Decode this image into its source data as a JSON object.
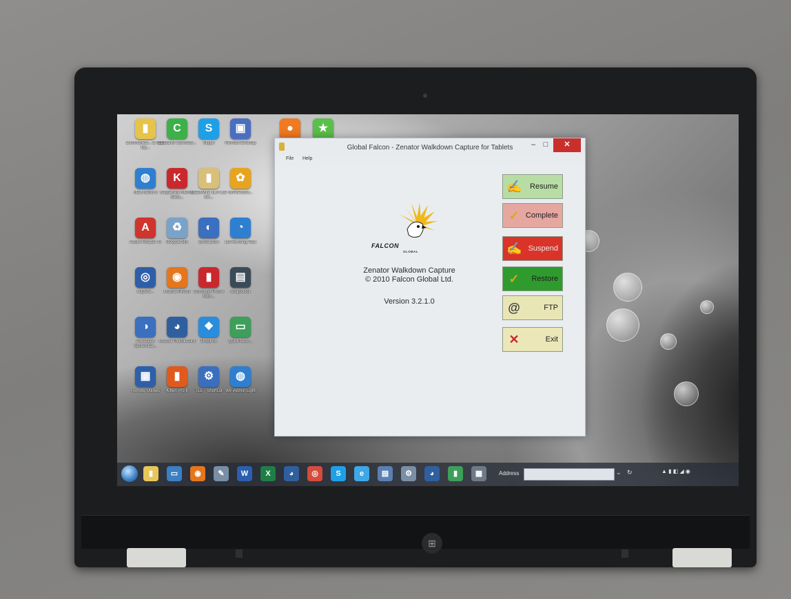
{
  "desktop": {
    "icons": [
      {
        "label": "Communica... & Start Up...",
        "color": "#e6c34a",
        "glyph": "▮"
      },
      {
        "label": "CCleaner Connecti...",
        "color": "#3db04a",
        "glyph": "C"
      },
      {
        "label": "Skype",
        "color": "#1ea0e8",
        "glyph": "S"
      },
      {
        "label": "Remote Desktop",
        "color": "#4a6fbf",
        "glyph": "▣"
      },
      {
        "label": "",
        "color": "#f07a22",
        "glyph": "●"
      },
      {
        "label": "",
        "color": "#5bbf4c",
        "glyph": "★"
      },
      {
        "label": "Start Menu 8",
        "color": "#2f7fd0",
        "glyph": "◍"
      },
      {
        "label": "Kaspersky Internet Secu...",
        "color": "#c9282d",
        "glyph": "K"
      },
      {
        "label": "ReadWrite 11.0 Lite UK...",
        "color": "#d8c07a",
        "glyph": "▮"
      },
      {
        "label": "GoToAssist...",
        "color": "#e8a41e",
        "glyph": "✿"
      },
      {
        "label": "Adobe Reader XI",
        "color": "#d0342c",
        "glyph": "A"
      },
      {
        "label": "Recycle Bin",
        "color": "#7aa3c9",
        "glyph": "♻"
      },
      {
        "label": "28.05.2014",
        "color": "#3b6fbf",
        "glyph": "◐"
      },
      {
        "label": "LG Running Tool",
        "color": "#2f7fd0",
        "glyph": "◔"
      },
      {
        "label": "wap5.5...",
        "color": "#2d5fa8",
        "glyph": "◎"
      },
      {
        "label": "Mozilla Firefox",
        "color": "#e4761d",
        "glyph": "◉"
      },
      {
        "label": "Combofix Phone Infor...",
        "color": "#c9282d",
        "glyph": "▮"
      },
      {
        "label": "wsapiclock",
        "color": "#3b4a57",
        "glyph": "▤"
      },
      {
        "label": "Advanced SystemCa...",
        "color": "#3b6fbf",
        "glyph": "◑"
      },
      {
        "label": "Mozilla Thunderbird",
        "color": "#2f5f9f",
        "glyph": "◕"
      },
      {
        "label": "Dropbox",
        "color": "#2a8cdc",
        "glyph": "❖"
      },
      {
        "label": "Quick Note...",
        "color": "#3d9f5a",
        "glyph": "▭"
      },
      {
        "label": "Remote Utilities",
        "color": "#2f5fa8",
        "glyph": "▦"
      },
      {
        "label": "Kitten Pro II",
        "color": "#e05a1e",
        "glyph": "▮"
      },
      {
        "label": "TEE - Shortcut",
        "color": "#3a6fbf",
        "glyph": "⚙"
      },
      {
        "label": "WiFiAdmin Light",
        "color": "#2f7fd0",
        "glyph": "◍"
      }
    ],
    "taskbar": {
      "items": [
        {
          "name": "explorer",
          "color": "#e7c65a",
          "glyph": "▮"
        },
        {
          "name": "monitor",
          "color": "#3b7fc4",
          "glyph": "▭"
        },
        {
          "name": "firefox",
          "color": "#e4761d",
          "glyph": "◉"
        },
        {
          "name": "tools",
          "color": "#7a8ea5",
          "glyph": "✎"
        },
        {
          "name": "word",
          "color": "#2b5fae",
          "glyph": "W"
        },
        {
          "name": "excel",
          "color": "#1f7d45",
          "glyph": "X"
        },
        {
          "name": "thunderbird",
          "color": "#2f5f9f",
          "glyph": "◕"
        },
        {
          "name": "chrome",
          "color": "#d54b3d",
          "glyph": "◎"
        },
        {
          "name": "skype",
          "color": "#1ea0e8",
          "glyph": "S"
        },
        {
          "name": "ie",
          "color": "#3ea8e6",
          "glyph": "e"
        },
        {
          "name": "notes",
          "color": "#5a7fb0",
          "glyph": "▤"
        },
        {
          "name": "utility",
          "color": "#7a8ea5",
          "glyph": "⚙"
        },
        {
          "name": "thunderbird-2",
          "color": "#2f5f9f",
          "glyph": "◕"
        },
        {
          "name": "falcon",
          "color": "#3d9f5a",
          "glyph": "▮"
        },
        {
          "name": "keyboard",
          "color": "#6d7a89",
          "glyph": "▦"
        }
      ],
      "address_label": "Address",
      "address_value": "",
      "clock_time": "",
      "clock_date": ""
    }
  },
  "app": {
    "title": "Global Falcon - Zenator Walkdown Capture for Tablets",
    "menu": [
      "File",
      "Help"
    ],
    "window_buttons": {
      "minimize": "–",
      "maximize": "□",
      "close": "✕"
    },
    "brand_name": "FALCON",
    "brand_sub": "GLOBAL",
    "product": "Zenator Walkdown Capture",
    "copyright": "©  2010 Falcon Global Ltd.",
    "version": "Version 3.2.1.0",
    "buttons": [
      {
        "label": "Resume",
        "icon": "document-icon",
        "glyph": "✍",
        "bg": "#b7dda5",
        "fg": "#1e1e1e",
        "icon_color": "#6b6b6b"
      },
      {
        "label": "Complete",
        "icon": "check-icon",
        "glyph": "✓",
        "bg": "#e6a7a0",
        "fg": "#1e1e1e",
        "icon_color": "#d6a91a"
      },
      {
        "label": "Suspend",
        "icon": "document-icon",
        "glyph": "✍",
        "bg": "#d9332a",
        "fg": "#e8e8e8",
        "icon_color": "#f2f2f2"
      },
      {
        "label": "Restore",
        "icon": "check-icon",
        "glyph": "✓",
        "bg": "#2f9b2f",
        "fg": "#1e1e1e",
        "icon_color": "#d6a91a"
      },
      {
        "label": "FTP",
        "icon": "at-icon",
        "glyph": "@",
        "bg": "#e9e6b6",
        "fg": "#1e1e1e",
        "icon_color": "#3b3b3b"
      },
      {
        "label": "Exit",
        "icon": "cross-icon",
        "glyph": "✕",
        "bg": "#ece7b9",
        "fg": "#1e1e1e",
        "icon_color": "#c9282d"
      }
    ]
  }
}
